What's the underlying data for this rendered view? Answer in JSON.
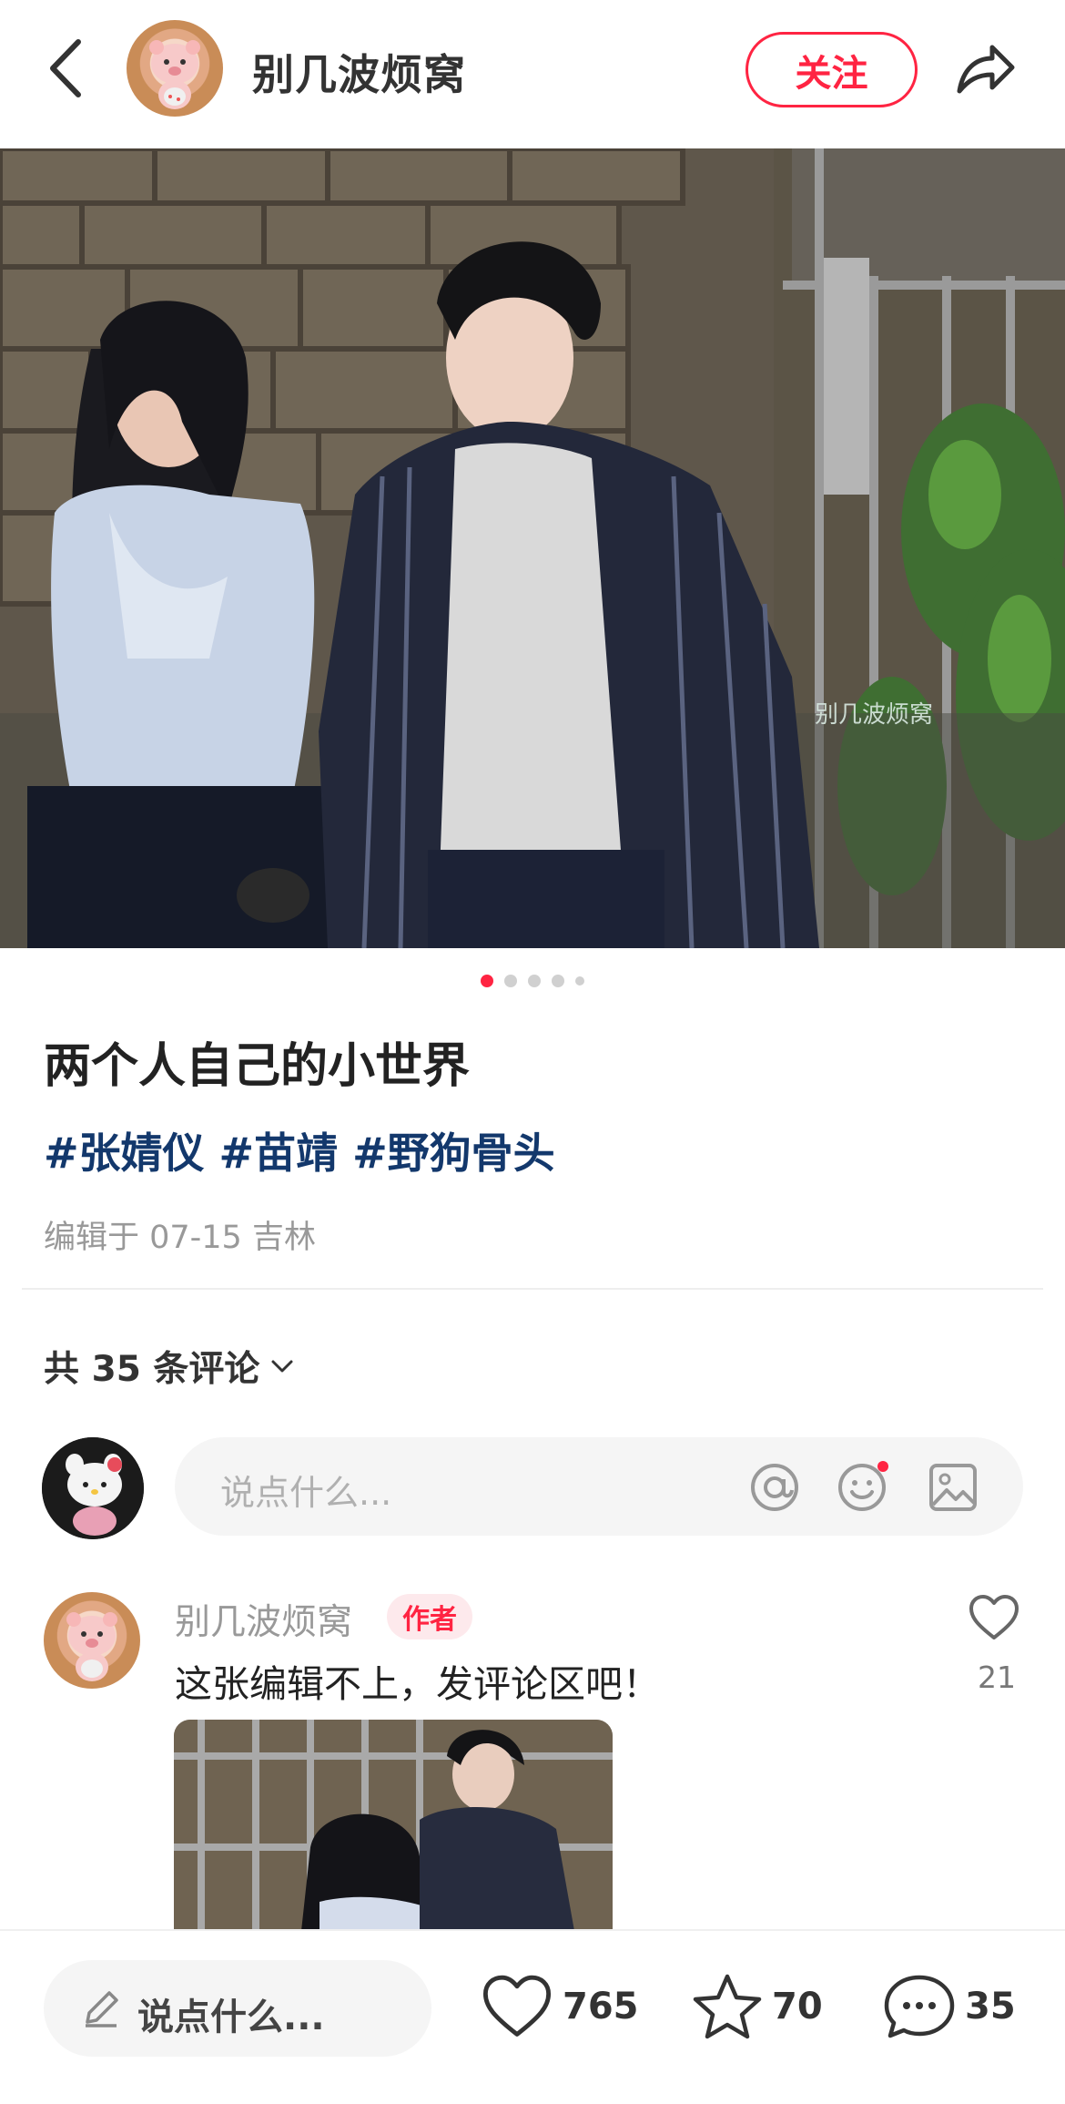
{
  "header": {
    "author_name": "别几波烦窝",
    "follow_label": "关注"
  },
  "carousel": {
    "count": 5,
    "active_index": 0,
    "watermark": "别几波烦窝"
  },
  "post": {
    "title": "两个人自己的小世界",
    "tags": [
      "#张婧仪",
      "#苗靖",
      "#野狗骨头"
    ],
    "edit_info": "编辑于 07-15 吉林"
  },
  "comments": {
    "count_label": "共 35 条评论",
    "input_placeholder": "说点什么...",
    "first": {
      "author": "别几波烦窝",
      "badge": "作者",
      "text": "这张编辑不上，发评论区吧！",
      "likes": "21"
    }
  },
  "bottom_bar": {
    "input_placeholder": "说点什么...",
    "likes": "765",
    "stars": "70",
    "comments": "35"
  },
  "colors": {
    "accent": "#ff2442",
    "tag": "#13386c",
    "muted": "#999999"
  },
  "icons": [
    "back-arrow-icon",
    "share-icon",
    "at-icon",
    "emoji-icon",
    "image-icon",
    "heart-icon",
    "pen-icon",
    "star-icon",
    "comment-icon",
    "chevron-down-icon"
  ]
}
